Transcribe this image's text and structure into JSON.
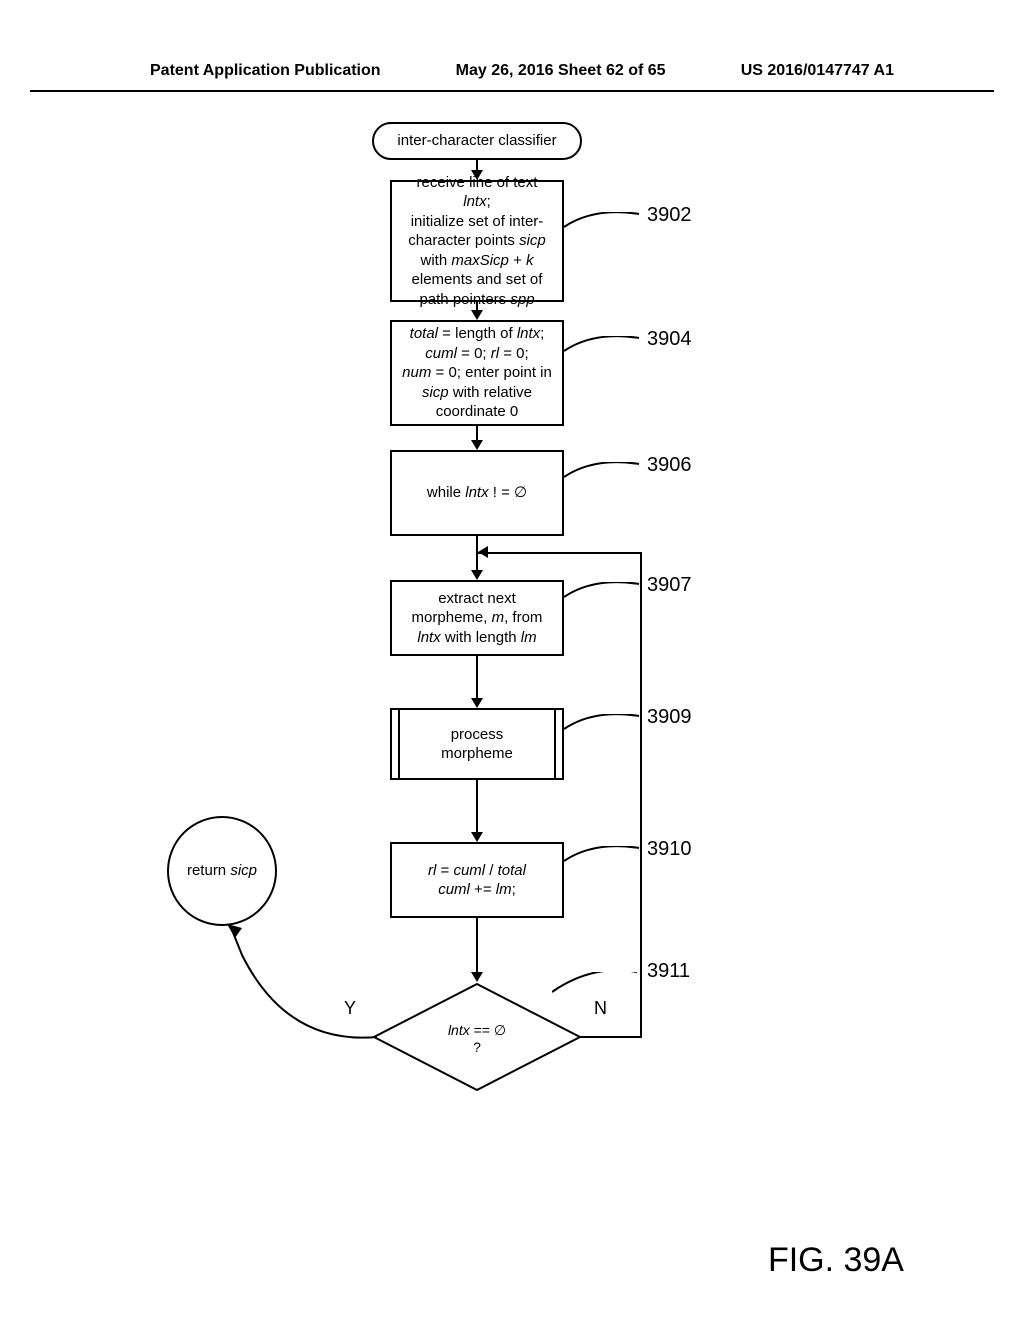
{
  "header": {
    "left": "Patent Application Publication",
    "center": "May 26, 2016  Sheet 62 of 65",
    "right": "US 2016/0147747 A1"
  },
  "chart_data": {
    "type": "flowchart",
    "title": "FIG. 39A",
    "nodes": [
      {
        "id": "start",
        "type": "terminal",
        "label": "inter-character classifier"
      },
      {
        "id": "3902",
        "type": "process",
        "ref": "3902",
        "label": "receive line of text lntx; initialize set of inter-character points sicp with maxSicp + k elements and set of path pointers spp"
      },
      {
        "id": "3904",
        "type": "process",
        "ref": "3904",
        "label": "total = length of lntx; cuml = 0; rl = 0; num = 0; enter point in sicp with relative coordinate 0"
      },
      {
        "id": "3906",
        "type": "process",
        "ref": "3906",
        "label": "while lntx ! = ∅"
      },
      {
        "id": "3907",
        "type": "process",
        "ref": "3907",
        "label": "extract next morpheme, m, from lntx with length lm"
      },
      {
        "id": "3909",
        "type": "subprocess",
        "ref": "3909",
        "label": "process morpheme"
      },
      {
        "id": "3910",
        "type": "process",
        "ref": "3910",
        "label": "rl = cuml / total  cuml += lm;"
      },
      {
        "id": "3911",
        "type": "decision",
        "ref": "3911",
        "label": "lntx == ∅ ?",
        "yes": "return",
        "no": "3907"
      },
      {
        "id": "return",
        "type": "terminal-circle",
        "label": "return sicp"
      }
    ],
    "edges": [
      {
        "from": "start",
        "to": "3902"
      },
      {
        "from": "3902",
        "to": "3904"
      },
      {
        "from": "3904",
        "to": "3906"
      },
      {
        "from": "3906",
        "to": "3907"
      },
      {
        "from": "3907",
        "to": "3909"
      },
      {
        "from": "3909",
        "to": "3910"
      },
      {
        "from": "3910",
        "to": "3911"
      },
      {
        "from": "3911",
        "to": "return",
        "label": "Y"
      },
      {
        "from": "3911",
        "to": "3907",
        "label": "N",
        "loop": true
      }
    ]
  },
  "labels": {
    "y": "Y",
    "n": "N",
    "figure": "FIG. 39A",
    "start": "inter-character classifier",
    "b3902_l1": "receive line of text ",
    "b3902_l1i": "lntx",
    "b3902_l1e": ";",
    "b3902_l2": "initialize set of inter-",
    "b3902_l3": "character points ",
    "b3902_l3i": "sicp",
    "b3902_l4": "with ",
    "b3902_l4i": "maxSicp + k",
    "b3902_l5": "elements and set of",
    "b3902_l6": "path pointers ",
    "b3902_l6i": "spp",
    "b3904_l1i": "total",
    "b3904_l1": " = length of ",
    "b3904_l1i2": "lntx",
    "b3904_l1e": ";",
    "b3904_l2i": "cuml",
    "b3904_l2": " = 0; ",
    "b3904_l2i2": "rl",
    "b3904_l2e": " = 0;",
    "b3904_l3i": "num",
    "b3904_l3": " = 0; enter point in",
    "b3904_l4i": "sicp",
    "b3904_l4": " with relative",
    "b3904_l5": "coordinate 0",
    "b3906_1": "while ",
    "b3906_i": "lntx",
    "b3906_2": " ! = ∅",
    "b3907_l1": "extract next",
    "b3907_l2a": "morpheme, ",
    "b3907_l2i": "m",
    "b3907_l2b": ", from",
    "b3907_l3i1": "lntx",
    "b3907_l3": " with length ",
    "b3907_l3i2": "lm",
    "b3909_l1": "process",
    "b3909_l2": "morpheme",
    "b3910_l1i1": "rl",
    "b3910_l1": " = ",
    "b3910_l1i2": "cuml",
    "b3910_l1b": " / ",
    "b3910_l1i3": "total",
    "b3910_l2i": "cuml",
    "b3910_l2": " += ",
    "b3910_l2i2": "lm",
    "b3910_l2e": ";",
    "b3911_i": "lntx",
    "b3911": " == ∅",
    "b3911_q": "?",
    "return_1": "return ",
    "return_i": "sicp",
    "r3902": "3902",
    "r3904": "3904",
    "r3906": "3906",
    "r3907": "3907",
    "r3909": "3909",
    "r3910": "3910",
    "r3911": "3911"
  }
}
